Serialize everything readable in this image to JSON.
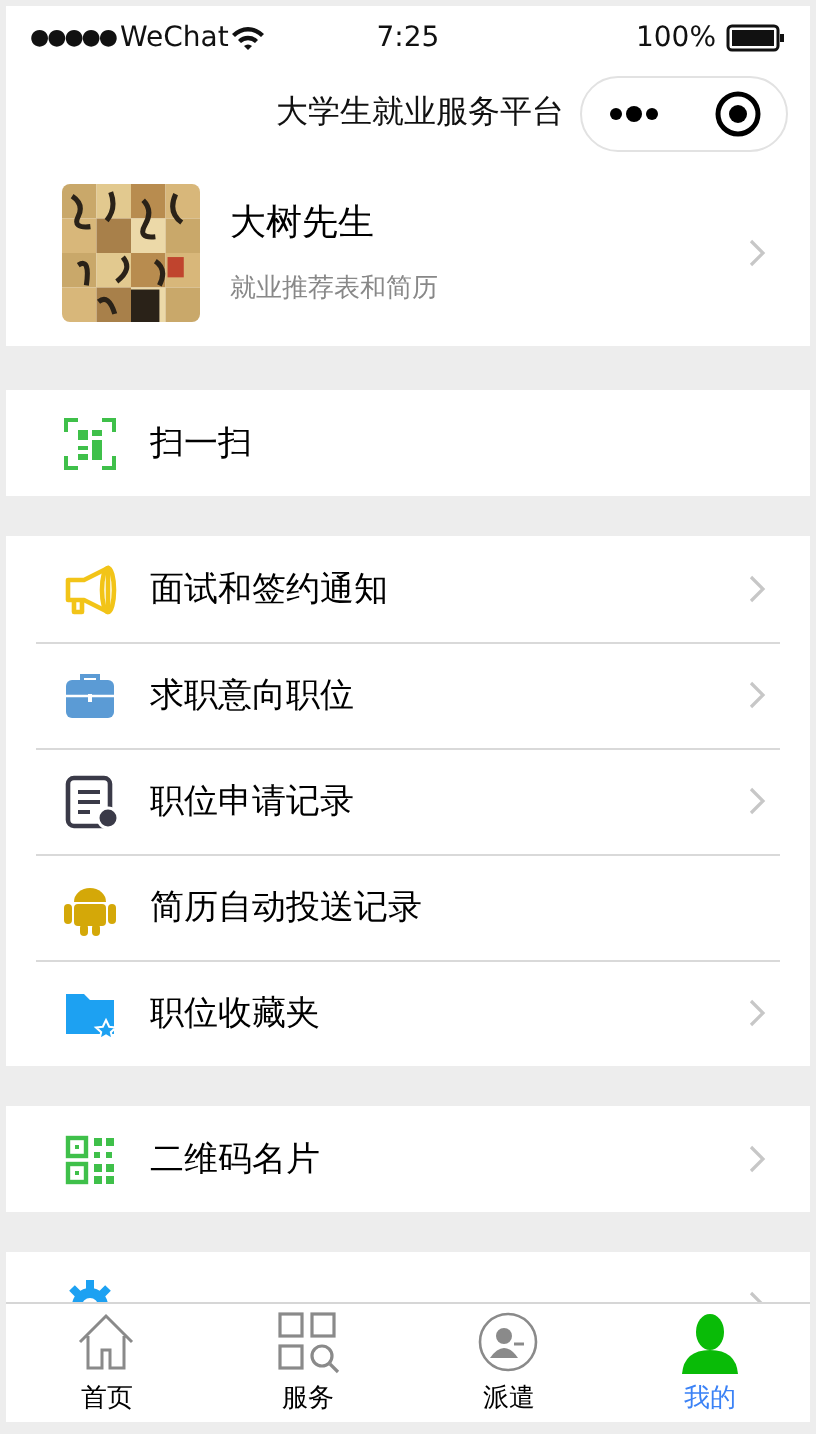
{
  "status_bar": {
    "signal": "●●●●●",
    "carrier": "WeChat",
    "time": "7:25",
    "battery": "100%"
  },
  "nav": {
    "title": "大学生就业服务平台"
  },
  "profile": {
    "name": "大树先生",
    "subtitle": "就业推荐表和简历",
    "arrow": true
  },
  "groups": [
    {
      "items": [
        {
          "kind": "scan",
          "label": "扫一扫",
          "arrow": false
        }
      ]
    },
    {
      "items": [
        {
          "kind": "megaphone",
          "label": "面试和签约通知",
          "arrow": true
        },
        {
          "kind": "briefcase",
          "label": "求职意向职位",
          "arrow": true
        },
        {
          "kind": "document",
          "label": "职位申请记录",
          "arrow": true
        },
        {
          "kind": "android",
          "label": "简历自动投送记录",
          "arrow": false
        },
        {
          "kind": "folder",
          "label": "职位收藏夹",
          "arrow": true
        }
      ]
    },
    {
      "items": [
        {
          "kind": "qrcode",
          "label": "二维码名片",
          "arrow": true
        }
      ]
    },
    {
      "items": [
        {
          "kind": "gear",
          "arrow": true
        }
      ]
    }
  ],
  "tabs": [
    {
      "kind": "home",
      "label": "首页",
      "selected": false
    },
    {
      "kind": "services",
      "label": "服务",
      "selected": false
    },
    {
      "kind": "dispatch",
      "label": "派遣",
      "selected": false
    },
    {
      "kind": "mine",
      "label": "我的",
      "selected": true
    }
  ]
}
